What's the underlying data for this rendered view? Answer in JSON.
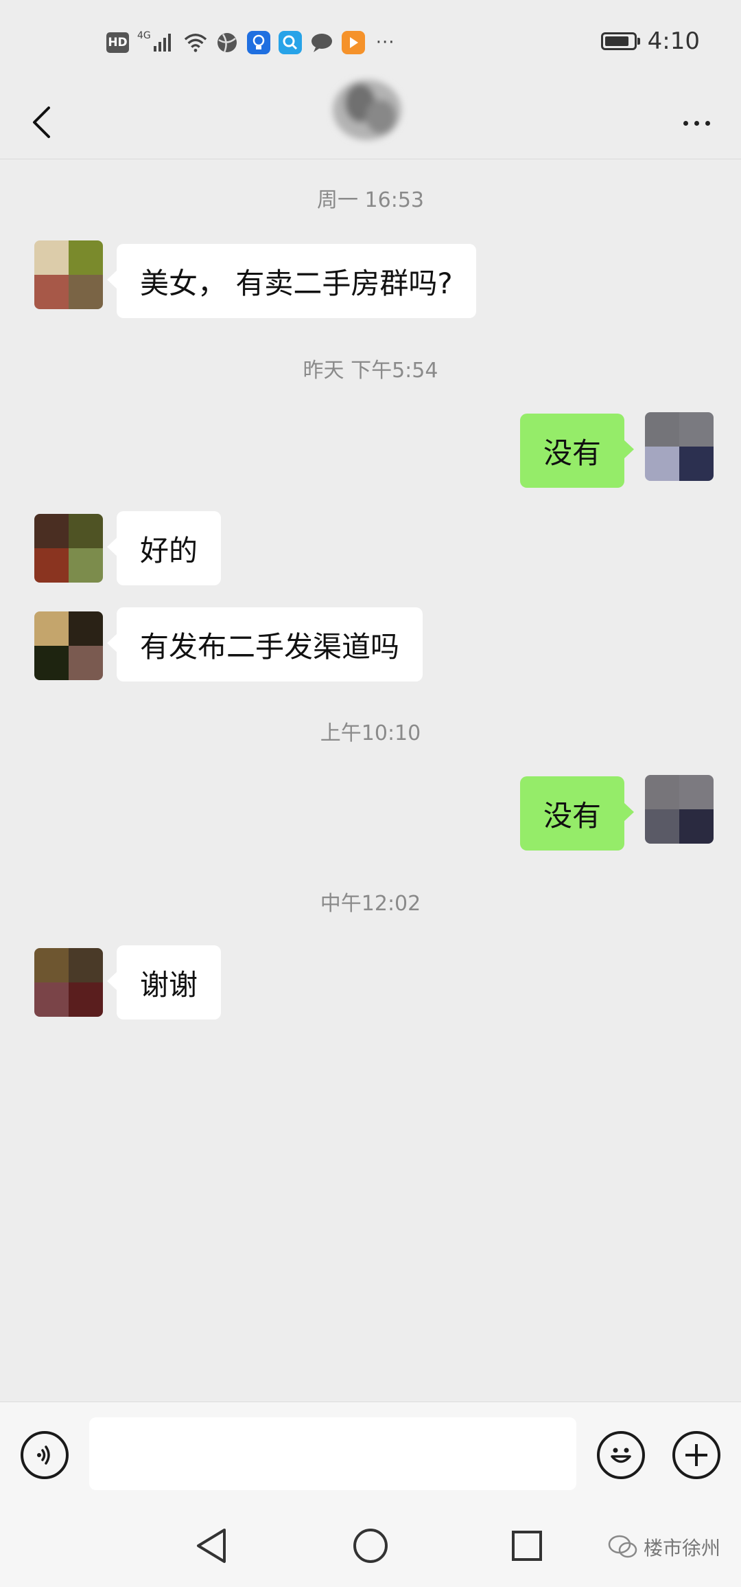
{
  "status_bar": {
    "hd_label": "HD",
    "network_label": "4G",
    "more_label": "···",
    "time": "4:10",
    "battery_level": 0.85
  },
  "chat": {
    "timestamps": [
      "周一 16:53",
      "昨天 下午5:54",
      "上午10:10",
      "中午12:02"
    ],
    "messages": [
      {
        "side": "in",
        "text": "美女， 有卖二手房群吗?"
      },
      {
        "side": "out",
        "text": "没有"
      },
      {
        "side": "in",
        "text": "好的"
      },
      {
        "side": "in",
        "text": "有发布二手发渠道吗"
      },
      {
        "side": "out",
        "text": "没有"
      },
      {
        "side": "in",
        "text": "谢谢"
      }
    ]
  },
  "input": {
    "value": "",
    "placeholder": ""
  },
  "watermark": {
    "text": "楼市徐州"
  },
  "colors": {
    "background": "#ededed",
    "incoming_bubble": "#ffffff",
    "outgoing_bubble": "#95ec69"
  }
}
